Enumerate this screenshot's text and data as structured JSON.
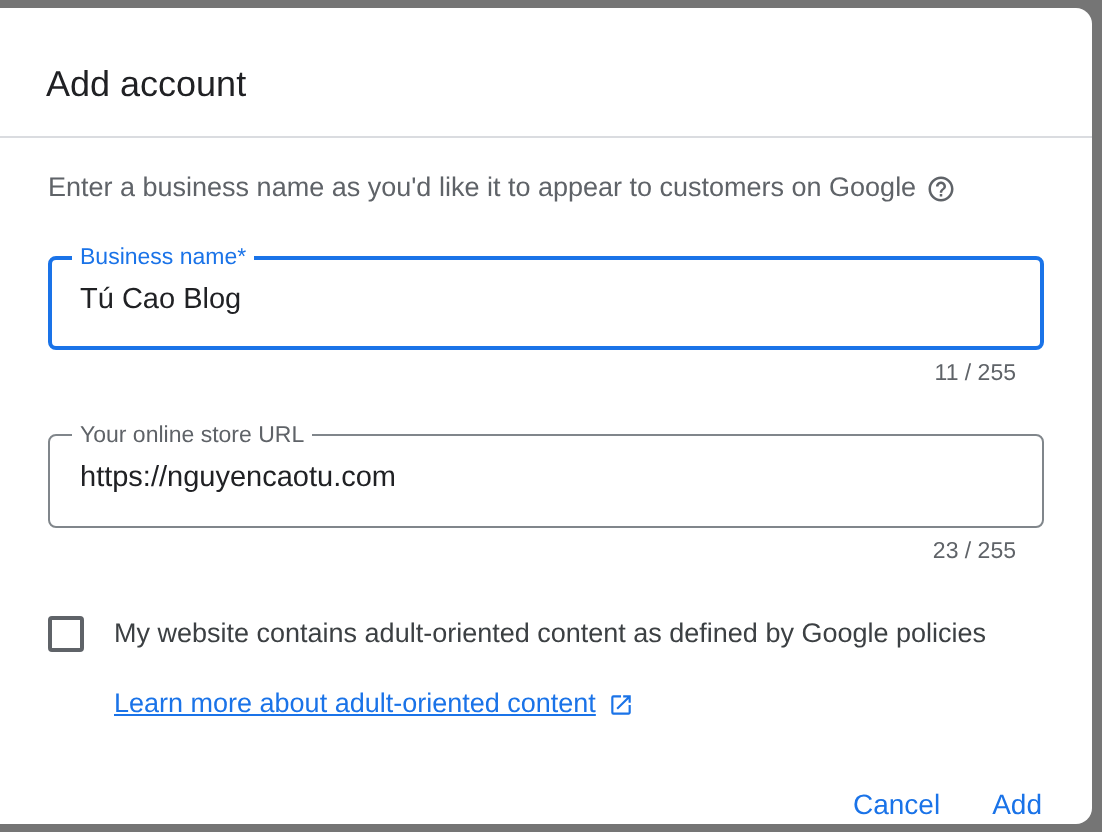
{
  "dialog": {
    "title": "Add account",
    "description": "Enter a business name as you'd like it to appear to customers on Google",
    "fields": [
      {
        "label": "Business name*",
        "value": "Tú Cao Blog",
        "counter": "11 / 255",
        "focused": true
      },
      {
        "label": "Your online store URL",
        "value": "https://nguyencaotu.com",
        "counter": "23 / 255",
        "focused": false
      }
    ],
    "checkbox": {
      "label": "My website contains adult-oriented content as defined by Google policies",
      "checked": false
    },
    "link": "Learn more about adult-oriented content",
    "buttons": [
      "Cancel",
      "Add"
    ]
  }
}
